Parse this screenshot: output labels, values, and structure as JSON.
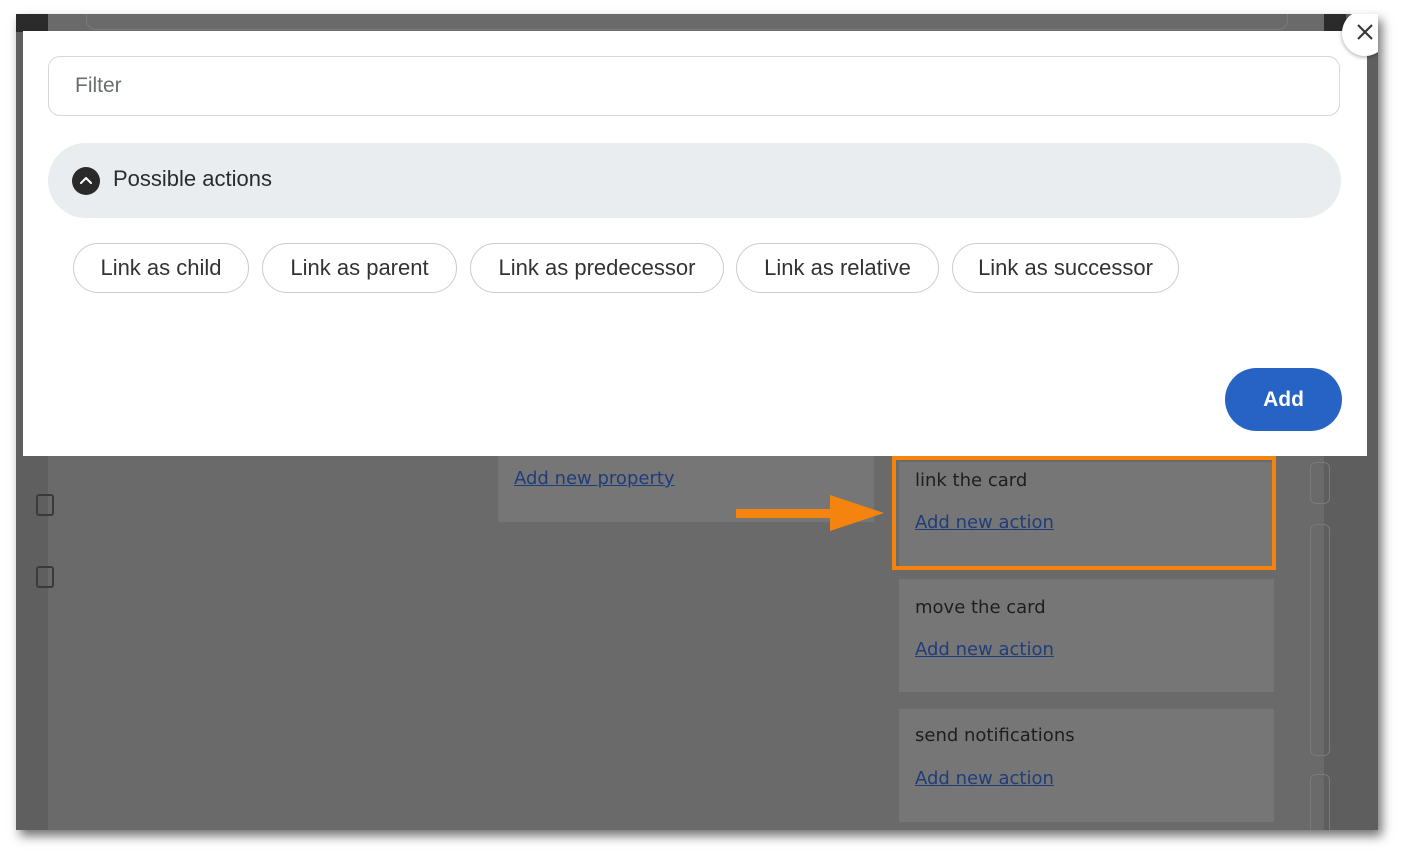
{
  "modal": {
    "filter_placeholder": "Filter",
    "section_title": "Possible actions",
    "chips": [
      "Link as child",
      "Link as parent",
      "Link as predecessor",
      "Link as relative",
      "Link as successor"
    ],
    "add_label": "Add"
  },
  "background": {
    "property_link": "Add new property",
    "rule_panels": [
      {
        "title": "link the card",
        "link": "Add new action"
      },
      {
        "title": "move the card",
        "link": "Add new action"
      },
      {
        "title": "send notifications",
        "link": "Add new action"
      }
    ]
  },
  "icons": {
    "collapse": "chevron-up-icon",
    "close": "close-icon",
    "annotation_arrow": "arrow-right-icon"
  },
  "colors": {
    "accent": "#2663c4",
    "highlight": "#f5840f",
    "overlay": "#6b6b6b"
  }
}
